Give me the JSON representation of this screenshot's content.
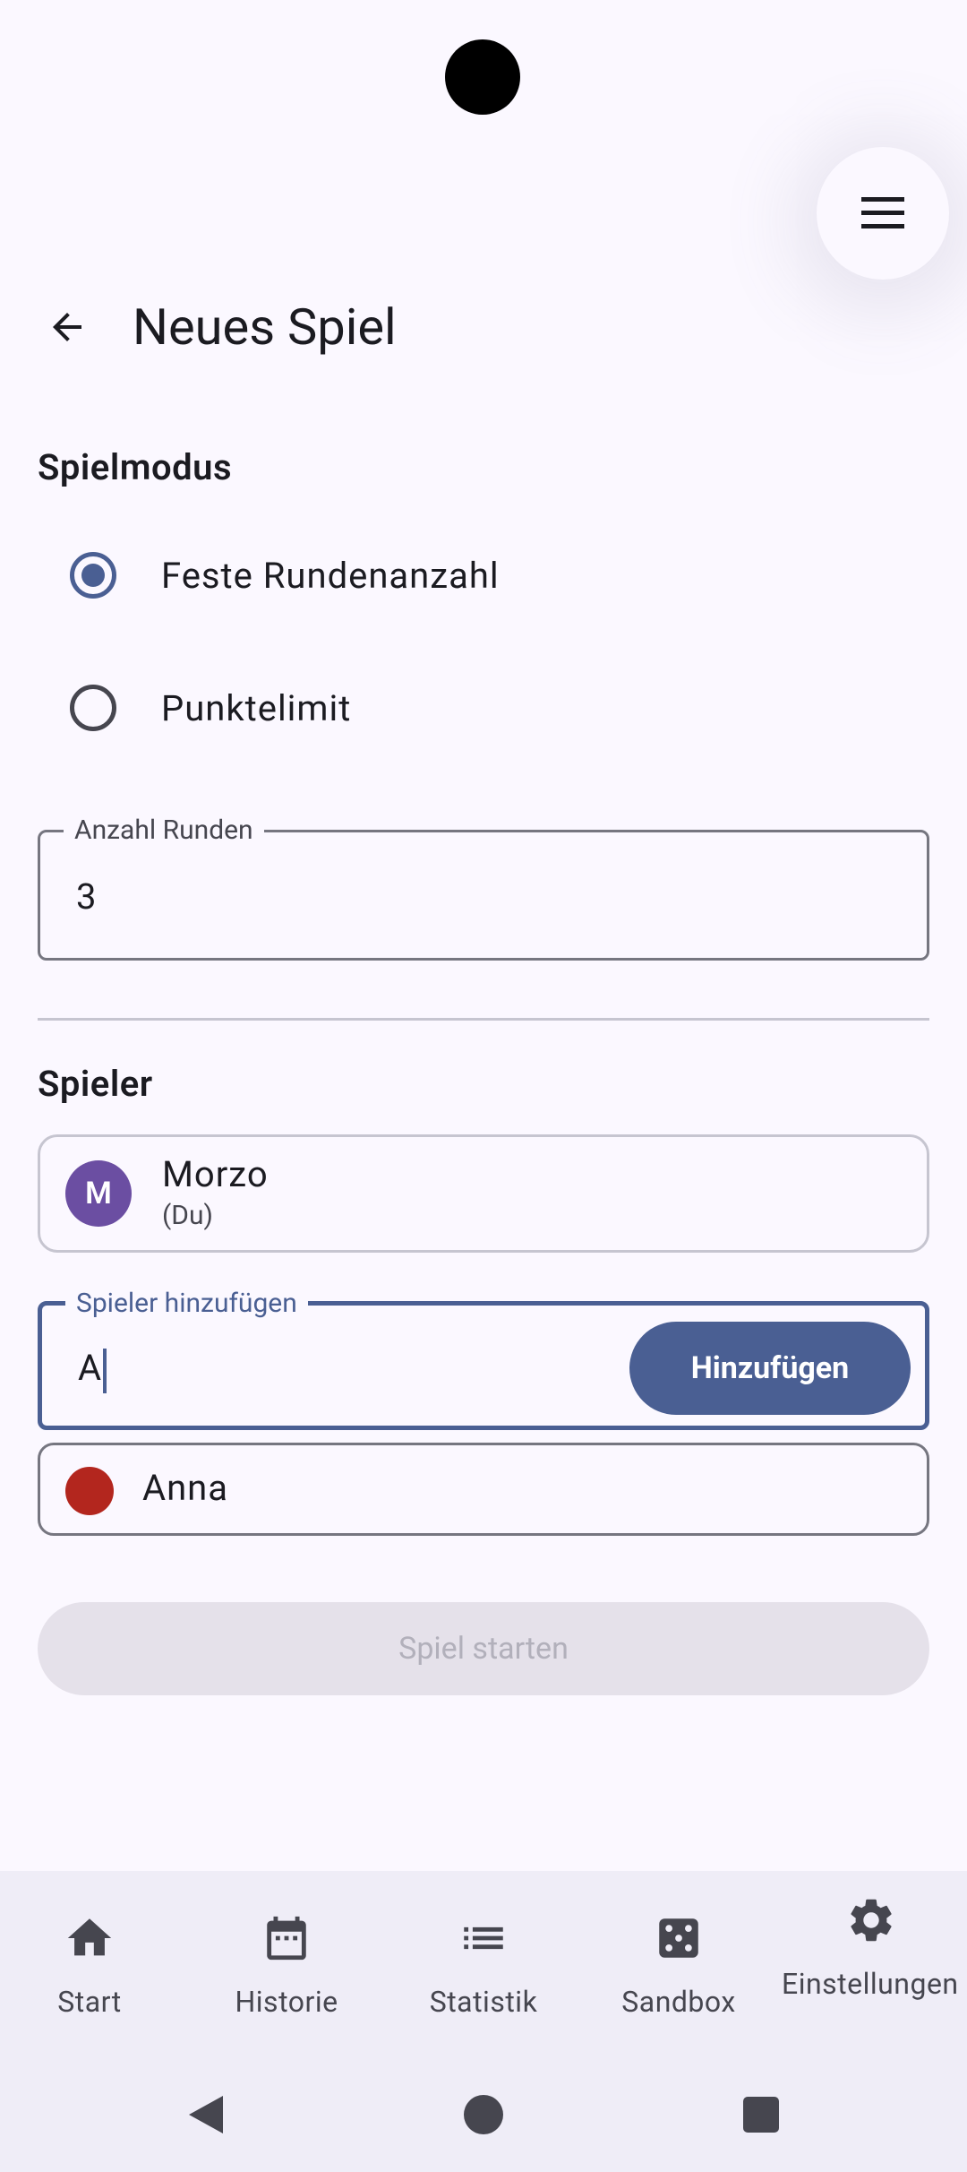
{
  "header": {
    "title": "Neues Spiel",
    "back_icon": "arrow-back-icon",
    "menu_icon": "hamburger-menu-icon"
  },
  "game_mode": {
    "label": "Spielmodus",
    "options": [
      {
        "label": "Feste Rundenanzahl",
        "selected": true
      },
      {
        "label": "Punktelimit",
        "selected": false
      }
    ]
  },
  "rounds_field": {
    "label": "Anzahl Runden",
    "value": "3"
  },
  "players": {
    "label": "Spieler",
    "list": [
      {
        "initial": "M",
        "name": "Morzo",
        "subtitle": "(Du)",
        "color": "#6b4ea2"
      }
    ]
  },
  "add_player": {
    "label": "Spieler hinzufügen",
    "value": "A",
    "button": "Hinzufügen",
    "suggestion": {
      "name": "Anna",
      "color": "#b3261e"
    }
  },
  "start_button": "Spiel starten",
  "nav": {
    "items": [
      {
        "label": "Start",
        "icon": "home-icon"
      },
      {
        "label": "Historie",
        "icon": "calendar-icon"
      },
      {
        "label": "Statistik",
        "icon": "list-icon"
      },
      {
        "label": "Sandbox",
        "icon": "dice-icon"
      },
      {
        "label": "Einstellungen",
        "icon": "gear-icon"
      }
    ]
  },
  "colors": {
    "accent": "#4a5f93",
    "background": "#fbf8ff",
    "nav_background": "#efedf7"
  }
}
